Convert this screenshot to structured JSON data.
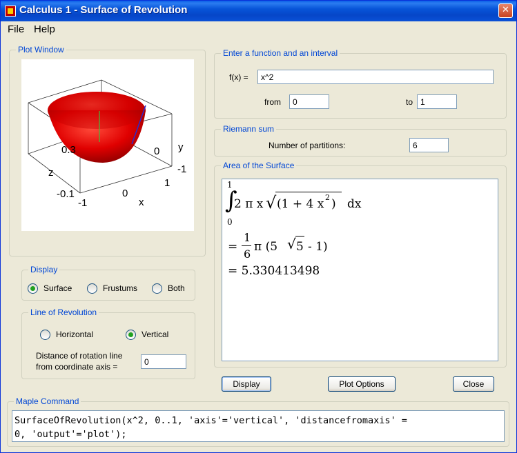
{
  "window": {
    "title": "Calculus 1 - Surface of Revolution",
    "close_glyph": "✕"
  },
  "menu": {
    "items": [
      "File",
      "Help"
    ]
  },
  "plot_window": {
    "title": "Plot Window",
    "axis_labels": {
      "y": "y",
      "z": "z",
      "x": "x"
    },
    "tick_labels": [
      "0.3",
      "0",
      "-1",
      "1",
      "-0.1",
      "-1",
      "0",
      "1"
    ]
  },
  "function_input": {
    "title": "Enter a function and an interval",
    "fx_label": "f(x) =",
    "fx_value": "x^2",
    "from_label": "from",
    "from_value": "0",
    "to_label": "to",
    "to_value": "1"
  },
  "riemann": {
    "title": "Riemann sum",
    "partitions_label": "Number of partitions:",
    "partitions_value": "6"
  },
  "area": {
    "title": "Area of the Surface",
    "upper_limit": "1",
    "lower_limit": "0",
    "integrand_prefix": "2 π x",
    "radicand": "(1 + 4 x",
    "radicand_exp": "2",
    "radicand_close": ")",
    "dx": "dx",
    "eq1_sign": "=",
    "frac_num": "1",
    "frac_den": "6",
    "eq1_rest_a": "π (5",
    "eq1_sqrt_arg": "5",
    "eq1_rest_b": "- 1)",
    "eq2": "= 5.330413498"
  },
  "display": {
    "title": "Display",
    "options": [
      "Surface",
      "Frustums",
      "Both"
    ],
    "selected": "Surface"
  },
  "line_of_revolution": {
    "title": "Line of Revolution",
    "options": [
      "Horizontal",
      "Vertical"
    ],
    "selected": "Vertical",
    "distance_label_1": "Distance of rotation line",
    "distance_label_2": "from coordinate axis =",
    "distance_value": "0"
  },
  "buttons": {
    "display": "Display",
    "plot_options": "Plot Options",
    "close": "Close"
  },
  "maple_command": {
    "title": "Maple Command",
    "line1": "SurfaceOfRevolution(x^2, 0..1, 'axis'='vertical', 'distancefromaxis' =",
    "line2": "0, 'output'='plot');"
  },
  "colors": {
    "accent": "#0046d5",
    "titlebar": "#0754d8",
    "surface": "#e00000",
    "radio_selected": "#21a121"
  }
}
